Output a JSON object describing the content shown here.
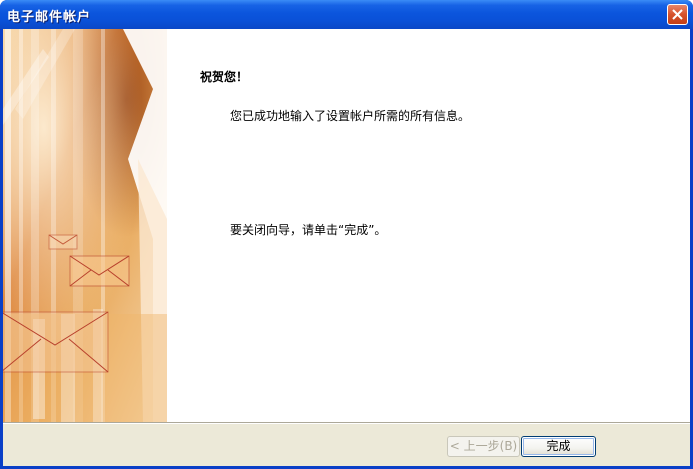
{
  "window": {
    "title": "电子邮件帐户"
  },
  "content": {
    "heading": "祝贺您！",
    "message_1": "您已成功地输入了设置帐户所需的所有信息。",
    "message_2": "要关闭向导，请单击“完成”。"
  },
  "buttons": {
    "back_label": "< 上一步(B)",
    "finish_label": "完成"
  },
  "icons": {
    "close": "close-icon",
    "banner": "envelope-banner-art"
  },
  "colors": {
    "titlebar": "#0a51d8",
    "client_bg": "#ece9d8",
    "banner_orange": "#d9792a",
    "close_red": "#d6522c"
  }
}
